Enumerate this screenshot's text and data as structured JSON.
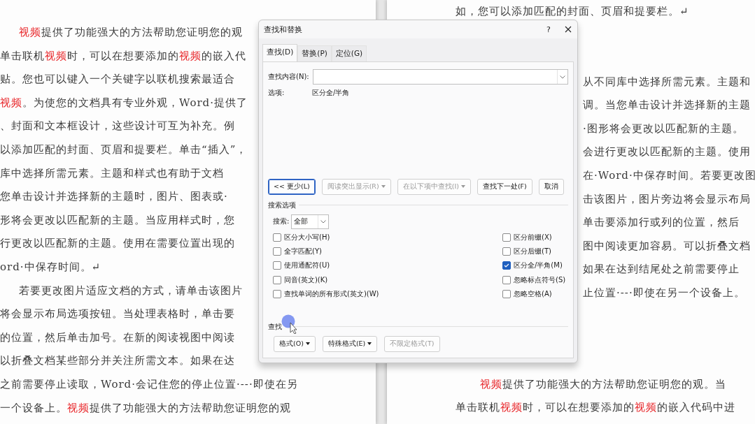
{
  "left_page": {
    "lines": [
      {
        "kind": "indent",
        "segments": [
          {
            "text": "视频",
            "highlight": true
          },
          {
            "text": "提供了功能强大的方法帮助您证明您的观",
            "highlight": false
          }
        ]
      },
      {
        "kind": "full",
        "segments": [
          {
            "text": "单击联机",
            "highlight": false
          },
          {
            "text": "视频",
            "highlight": true
          },
          {
            "text": "时，可以在想要添加的",
            "highlight": false
          },
          {
            "text": "视频",
            "highlight": true
          },
          {
            "text": "的嵌入代",
            "highlight": false
          }
        ]
      },
      {
        "kind": "full",
        "segments": [
          {
            "text": "贴。您也可以键入一个关键字以联机搜索最适合",
            "highlight": false
          }
        ]
      },
      {
        "kind": "full",
        "segments": [
          {
            "text": "视频",
            "highlight": true
          },
          {
            "text": "。为使您的文档具有专业外观，Word·提供了",
            "highlight": false
          }
        ]
      },
      {
        "kind": "full",
        "segments": [
          {
            "text": "、封面和文本框设计，这些设计可互为补充。例",
            "highlight": false
          }
        ]
      },
      {
        "kind": "full",
        "segments": [
          {
            "text": "以添加匹配的封面、页眉和提要栏。单击“插入”，",
            "highlight": false
          }
        ]
      },
      {
        "kind": "full",
        "segments": [
          {
            "text": "库中选择所需元素。主题和样式也有助于文档",
            "highlight": false
          }
        ]
      },
      {
        "kind": "full",
        "segments": [
          {
            "text": "您单击设计并选择新的主题时，图片、图表或·",
            "highlight": false
          }
        ]
      },
      {
        "kind": "full",
        "segments": [
          {
            "text": "形将会更改以匹配新的主题。当应用样式时，您",
            "highlight": false
          }
        ]
      },
      {
        "kind": "full",
        "segments": [
          {
            "text": "行更改以匹配新的主题。使用在需要位置出现的",
            "highlight": false
          }
        ]
      },
      {
        "kind": "full",
        "segments": [
          {
            "text": "ord·中保存时间。↵",
            "highlight": false
          }
        ]
      },
      {
        "kind": "indent",
        "segments": [
          {
            "text": "若要更改图片适应文档的方式，请单击该图片",
            "highlight": false
          }
        ]
      },
      {
        "kind": "full",
        "segments": [
          {
            "text": "将会显示布局选项按钮。当处理表格时，单击要",
            "highlight": false
          }
        ]
      },
      {
        "kind": "full",
        "segments": [
          {
            "text": "的位置，然后单击加号。在新的阅读视图中阅读",
            "highlight": false
          }
        ]
      },
      {
        "kind": "full",
        "segments": [
          {
            "text": "以折叠文档某些部分并关注所需文本。如果在达",
            "highlight": false
          }
        ]
      },
      {
        "kind": "full",
        "segments": [
          {
            "text": "之前需要停止读取，Word·会记住您的停止位置·--·即使在另",
            "highlight": false
          }
        ]
      },
      {
        "kind": "full",
        "segments": [
          {
            "text": "一个设备上。",
            "highlight": false
          },
          {
            "text": "视频",
            "highlight": true
          },
          {
            "text": "提供了功能强大的方法帮助您证明您的观",
            "highlight": false
          }
        ]
      }
    ]
  },
  "right_page": {
    "blocks": [
      {
        "lines": [
          {
            "kind": "full",
            "segments": [
              {
                "text": "如，您可以添加匹配的封面、页眉和提要栏。↵",
                "highlight": false
              }
            ]
          }
        ]
      },
      {
        "lines": [
          {
            "kind": "clipped",
            "segments": [
              {
                "text": "从不同库中选择所需元素。主题和",
                "highlight": false
              }
            ]
          },
          {
            "kind": "clipped",
            "segments": [
              {
                "text": "调。当您单击设计并选择新的主题",
                "highlight": false
              }
            ]
          },
          {
            "kind": "clipped",
            "segments": [
              {
                "text": "·图形将会更改以匹配新的主题。",
                "highlight": false
              }
            ]
          },
          {
            "kind": "clipped",
            "segments": [
              {
                "text": "会进行更改以匹配新的主题。使用",
                "highlight": false
              }
            ]
          },
          {
            "kind": "clipped",
            "segments": [
              {
                "text": "在·Word·中保存时间。若要更改图",
                "highlight": false
              }
            ]
          },
          {
            "kind": "clipped",
            "segments": [
              {
                "text": "击该图片，图片旁边将会显示布局",
                "highlight": false
              }
            ]
          },
          {
            "kind": "clipped",
            "segments": [
              {
                "text": "单击要添加行或列的位置，然后",
                "highlight": false
              }
            ]
          },
          {
            "kind": "clipped",
            "segments": [
              {
                "text": "图中阅读更加容易。可以折叠文档",
                "highlight": false
              }
            ]
          },
          {
            "kind": "clipped",
            "segments": [
              {
                "text": "如果在达到结尾处之前需要停止",
                "highlight": false
              }
            ]
          },
          {
            "kind": "clipped",
            "segments": [
              {
                "text": "止位置·--·即使在另一个设备上。",
                "highlight": false
              }
            ]
          }
        ]
      },
      {
        "lines": [
          {
            "kind": "indent",
            "segments": [
              {
                "text": "视频",
                "highlight": true
              },
              {
                "text": "提供了功能强大的方法帮助您证明您的观。当",
                "highlight": false
              }
            ]
          },
          {
            "kind": "full",
            "segments": [
              {
                "text": "单击联机",
                "highlight": false
              },
              {
                "text": "视频",
                "highlight": true
              },
              {
                "text": "时，可以在想要添加的",
                "highlight": false
              },
              {
                "text": "视频",
                "highlight": true
              },
              {
                "text": "的嵌入代码中进",
                "highlight": false
              }
            ]
          }
        ]
      }
    ]
  },
  "dialog": {
    "title": "查找和替换",
    "help": "?",
    "tabs": [
      {
        "label": "查找(D)",
        "selected": true
      },
      {
        "label": "替换(P)",
        "selected": false
      },
      {
        "label": "定位(G)",
        "selected": false
      }
    ],
    "find_field": {
      "label": "查找内容(N):"
    },
    "options_label": "选项:",
    "options_value": "区分全/半角",
    "buttons": [
      {
        "label": "<< 更少(L)",
        "disabled": false,
        "focused": true,
        "dropdown": false
      },
      {
        "label": "阅读突出显示(R)",
        "disabled": true,
        "focused": false,
        "dropdown": true
      },
      {
        "label": "在以下项中查找(I)",
        "disabled": true,
        "focused": false,
        "dropdown": true
      },
      {
        "label": "查找下一处(F)",
        "disabled": false,
        "focused": false,
        "dropdown": false
      },
      {
        "label": "取消",
        "disabled": false,
        "focused": false,
        "dropdown": false
      }
    ],
    "search_options": {
      "title": "搜索选项",
      "search_label": "搜索:",
      "search_value": "全部",
      "left": [
        {
          "label": "区分大小写(H)",
          "checked": false
        },
        {
          "label": "全字匹配(Y)",
          "checked": false
        },
        {
          "label": "使用通配符(U)",
          "checked": false
        },
        {
          "label": "同音(英文)(K)",
          "checked": false
        },
        {
          "label": "查找单词的所有形式(英文)(W)",
          "checked": false
        }
      ],
      "right": [
        {
          "label": "区分前缀(X)",
          "checked": false
        },
        {
          "label": "区分后缀(T)",
          "checked": false
        },
        {
          "label": "区分全/半角(M)",
          "checked": true
        },
        {
          "label": "忽略标点符号(S)",
          "checked": false
        },
        {
          "label": "忽略空格(A)",
          "checked": false
        }
      ]
    },
    "find_section": {
      "title": "查找",
      "buttons": [
        {
          "label": "格式(O)",
          "disabled": false,
          "dropdown": true
        },
        {
          "label": "特殊格式(E)",
          "disabled": false,
          "dropdown": true
        },
        {
          "label": "不限定格式(T)",
          "disabled": true,
          "dropdown": false
        }
      ]
    }
  }
}
